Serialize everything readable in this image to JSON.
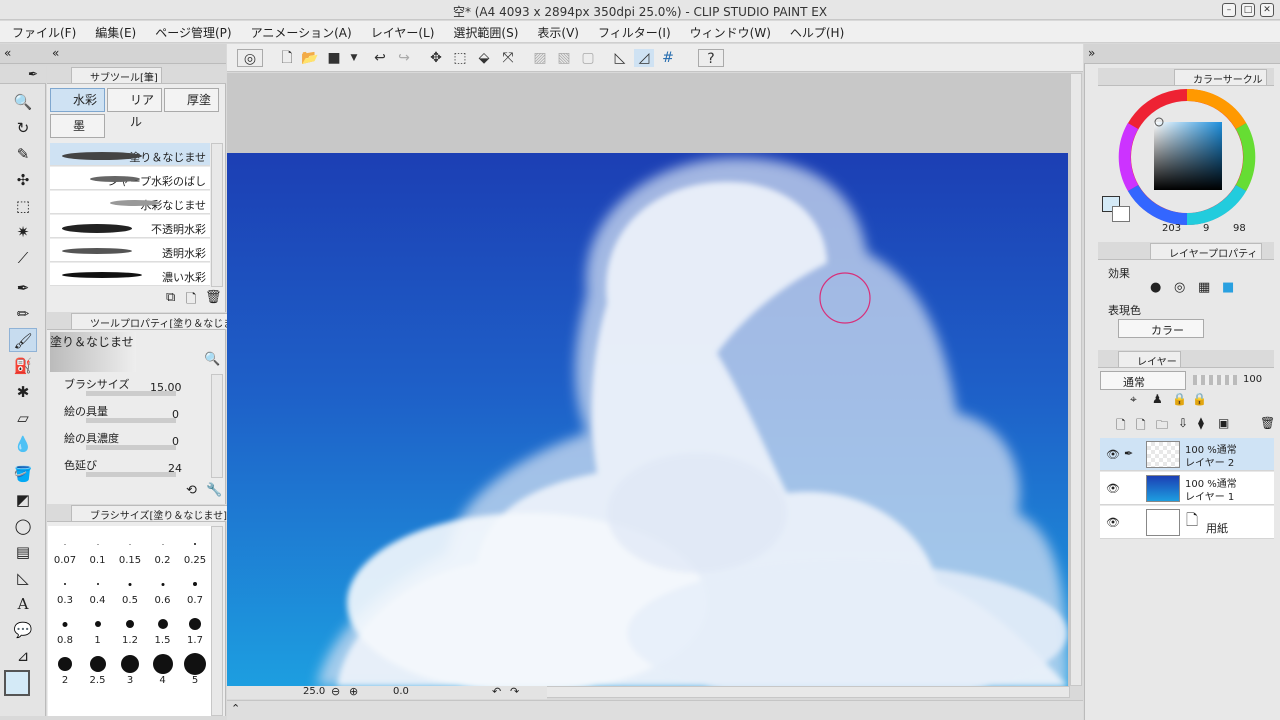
{
  "window": {
    "title": "空* (A4 4093 x 2894px 350dpi 25.0%) - CLIP STUDIO PAINT EX"
  },
  "menu": [
    "ファイル(F)",
    "編集(E)",
    "ページ管理(P)",
    "アニメーション(A)",
    "レイヤー(L)",
    "選択範囲(S)",
    "表示(V)",
    "フィルター(I)",
    "ウィンドウ(W)",
    "ヘルプ(H)"
  ],
  "subtool": {
    "tab": "サブツール[筆]",
    "groups": [
      "水彩",
      "リアル",
      "厚塗",
      "墨"
    ],
    "brushes": [
      "塗り＆なじませ",
      "シャープ水彩のばし",
      "水彩なじませ",
      "不透明水彩",
      "透明水彩",
      "濃い水彩"
    ]
  },
  "toolprop": {
    "tab": "ツールプロパティ[塗り＆なじませ]",
    "name": "塗り＆なじませ",
    "rows": [
      {
        "label": "ブラシサイズ",
        "value": "15.00"
      },
      {
        "label": "絵の具量",
        "value": "0"
      },
      {
        "label": "絵の具濃度",
        "value": "0"
      },
      {
        "label": "色延び",
        "value": "24"
      }
    ]
  },
  "brushsize": {
    "tab": "ブラシサイズ[塗り＆なじませ]",
    "sizes": [
      "0.07",
      "0.1",
      "0.15",
      "0.2",
      "0.25",
      "0.3",
      "0.4",
      "0.5",
      "0.6",
      "0.7",
      "0.8",
      "1",
      "1.2",
      "1.5",
      "1.7",
      "2",
      "2.5",
      "3",
      "4",
      "5"
    ]
  },
  "status": {
    "zoom": "25.0",
    "rotation": "0.0"
  },
  "color": {
    "tab": "カラーサークル",
    "h": "203",
    "s": "9",
    "v": "98",
    "fg": "#d4eaf7"
  },
  "layerprop": {
    "tab": "レイヤープロパティ",
    "effect_label": "効果",
    "expression_label": "表現色",
    "expression_value": "カラー"
  },
  "layers": {
    "tab": "レイヤー",
    "blend": "通常",
    "opacity": "100",
    "items": [
      {
        "pct": "100 %通常",
        "name": "レイヤー 2"
      },
      {
        "pct": "100 %通常",
        "name": "レイヤー 1"
      },
      {
        "pct": "",
        "name": "用紙"
      }
    ]
  }
}
